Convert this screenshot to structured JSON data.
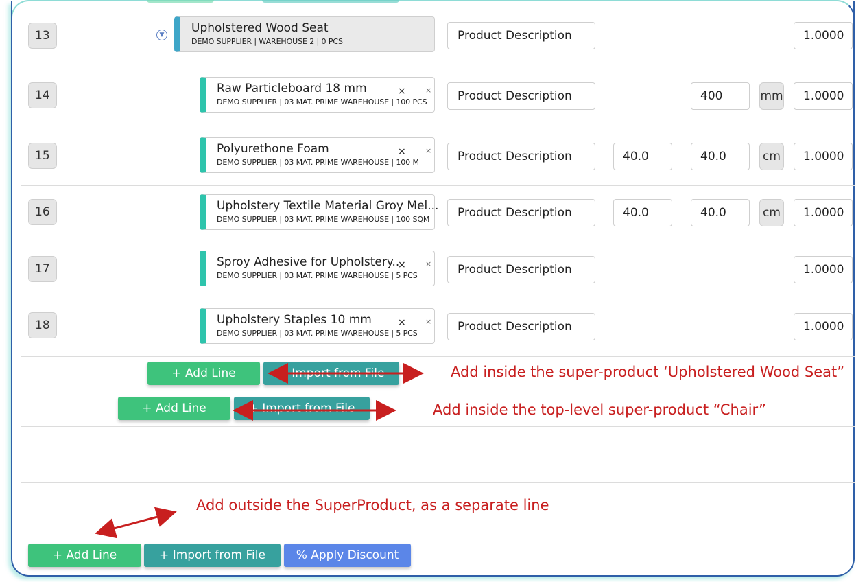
{
  "rows": [
    {
      "num": "13",
      "name": "Upholstered Wood Seat",
      "sub": "DEMO SUPPLIER | WAREHOUSE 2 | 0 PCS",
      "desc": "Product Description",
      "qty": "1.0000"
    },
    {
      "num": "14",
      "name": "Raw Particleboard 18 mm",
      "sub": "DEMO SUPPLIER | 03 MAT. PRIME WAREHOUSE | 100 PCS",
      "desc": "Product Description",
      "dim2": "400",
      "unit": "mm",
      "qty": "1.0000"
    },
    {
      "num": "15",
      "name": "Polyurethone Foam",
      "sub": "DEMO SUPPLIER | 03 MAT. PRIME WAREHOUSE | 100 M",
      "desc": "Product Description",
      "dim1": "40.0",
      "dim2": "40.0",
      "unit": "cm",
      "qty": "1.0000"
    },
    {
      "num": "16",
      "name": "Upholstery Textile Material Groy Mel...",
      "sub": "DEMO SUPPLIER | 03 MAT. PRIME WAREHOUSE | 100 SQM",
      "desc": "Product Description",
      "dim1": "40.0",
      "dim2": "40.0",
      "unit": "cm",
      "qty": "1.0000"
    },
    {
      "num": "17",
      "name": "Sproy Adhesive for Upholstery...",
      "sub": "DEMO SUPPLIER | 03 MAT. PRIME WAREHOUSE | 5 PCS",
      "desc": "Product Description",
      "qty": "1.0000"
    },
    {
      "num": "18",
      "name": "Upholstery Staples 10 mm",
      "sub": "DEMO SUPPLIER | 03 MAT. PRIME WAREHOUSE | 5 PCS",
      "desc": "Product Description",
      "qty": "1.0000"
    }
  ],
  "remove_glyph": "×",
  "collapse_icon": "chevron-down-icon",
  "buttons": {
    "add_line": "+ Add Line",
    "import_file": "+ Import from File",
    "apply_discount": "% Apply Discount"
  },
  "annotations": {
    "inner": "Add inside the super-product ‘Upholstered Wood Seat”",
    "top": "Add inside the top-level super-product “Chair”",
    "outside": "Add outside the SuperProduct, as a separate line"
  },
  "colors": {
    "add_green": "#3ec37c",
    "import_teal": "#37a19e",
    "discount_blue": "#5b86e8",
    "child_accent": "#2ec4ac",
    "parent_accent": "#3ea6c8",
    "annotation_red": "#c81f1f"
  }
}
